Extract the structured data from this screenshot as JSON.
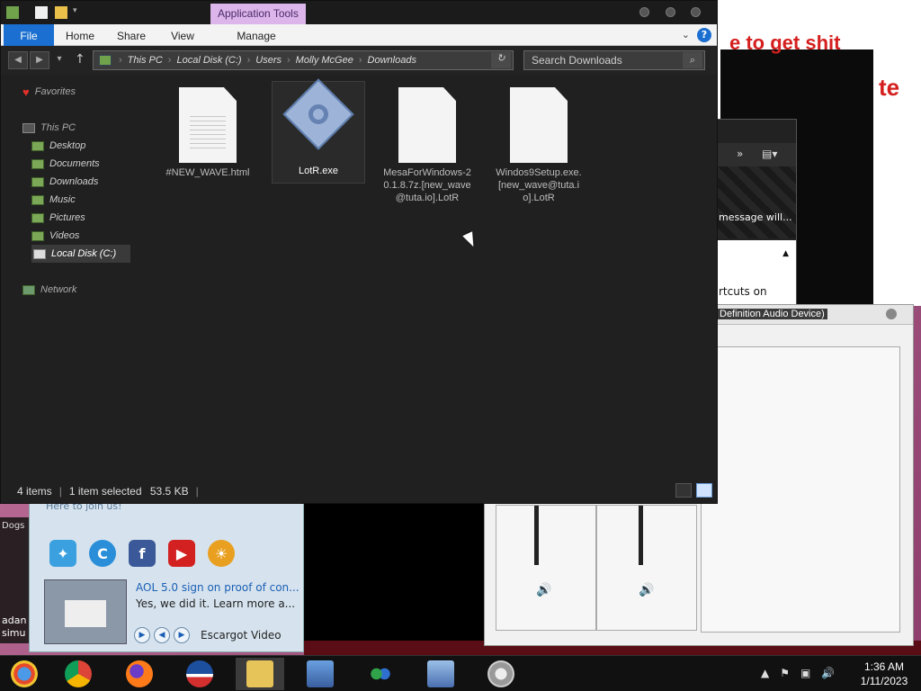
{
  "explorer": {
    "ribbon_context_tab": "Application Tools",
    "ribbon_tabs": [
      "File",
      "Home",
      "Share",
      "View",
      "Manage"
    ],
    "breadcrumb": [
      "This PC",
      "Local Disk (C:)",
      "Users",
      "Molly McGee",
      "Downloads"
    ],
    "search_placeholder": "Search Downloads",
    "sidebar": {
      "favorites": "Favorites",
      "this_pc": "This PC",
      "items": [
        "Desktop",
        "Documents",
        "Downloads",
        "Music",
        "Pictures",
        "Videos",
        "Local Disk (C:)"
      ],
      "network": "Network"
    },
    "files": [
      {
        "name": "#NEW_WAVE.html",
        "kind": "document"
      },
      {
        "name": "LotR.exe",
        "kind": "executable"
      },
      {
        "name": "MesaForWindows-20.1.8.7z.[new_wave@tuta.io].LotR",
        "kind": "blank"
      },
      {
        "name": "Windos9Setup.exe.[new_wave@tuta.io].LotR",
        "kind": "blank"
      }
    ],
    "status": {
      "items": "4 items",
      "selected": "1 item selected",
      "size": "53.5 KB"
    }
  },
  "background": {
    "web_text1": "e to get shit",
    "web_text2": "te",
    "dialog_message": "message will...",
    "dialog_shortcuts": "rtcuts on",
    "audio_title": "Definition Audio Device)",
    "news_join": "Here to join us!",
    "news_link": "AOL 5.0 sign on proof of con...",
    "news_desc": "Yes, we did it. Learn more a...",
    "news_video": "Escargot Video",
    "left_text1": "Dogs",
    "left_text2": "adan",
    "left_text3": "simu"
  },
  "taskbar": {
    "time": "1:36 AM",
    "date": "1/11/2023"
  },
  "colors": {
    "accent": "#1a6fd0",
    "context_tab": "#dcb6ea",
    "explorer_bg": "#202020"
  }
}
